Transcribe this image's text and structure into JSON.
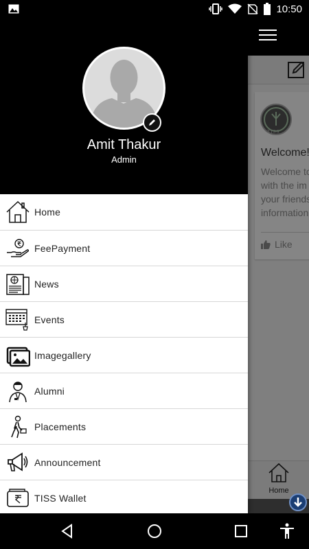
{
  "status_bar": {
    "time": "10:50",
    "icons": [
      "image-icon",
      "vibrate-icon",
      "wifi-icon",
      "no-sim-icon",
      "battery-icon"
    ]
  },
  "app_background": {
    "welcome_title": "Welcome!",
    "welcome_body_lines": [
      "Welcome to",
      "with the im",
      "your friends",
      "information"
    ],
    "logo_text": "TISS",
    "like_label": "Like",
    "bottom_tab_label": "Home"
  },
  "drawer": {
    "user_name": "Amit Thakur",
    "user_role": "Admin",
    "menu": [
      {
        "label": "Home",
        "icon": "home-icon"
      },
      {
        "label": "FeePayment",
        "icon": "fee-payment-icon"
      },
      {
        "label": "News",
        "icon": "news-icon"
      },
      {
        "label": "Events",
        "icon": "events-icon"
      },
      {
        "label": "Imagegallery",
        "icon": "image-gallery-icon"
      },
      {
        "label": "Alumni",
        "icon": "alumni-icon"
      },
      {
        "label": "Placements",
        "icon": "placements-icon"
      },
      {
        "label": "Announcement",
        "icon": "announcement-icon"
      },
      {
        "label": "TISS Wallet",
        "icon": "wallet-icon"
      }
    ]
  },
  "nav_bar": {
    "buttons": [
      "back-icon",
      "home-circle-icon",
      "recents-icon",
      "accessibility-icon"
    ]
  },
  "colors": {
    "drawer_header": "#000000",
    "drawer_bg": "#ffffff",
    "scrim": "#7f7f7f",
    "divider": "#d6d6d6",
    "download_button": "#1b3e73"
  }
}
